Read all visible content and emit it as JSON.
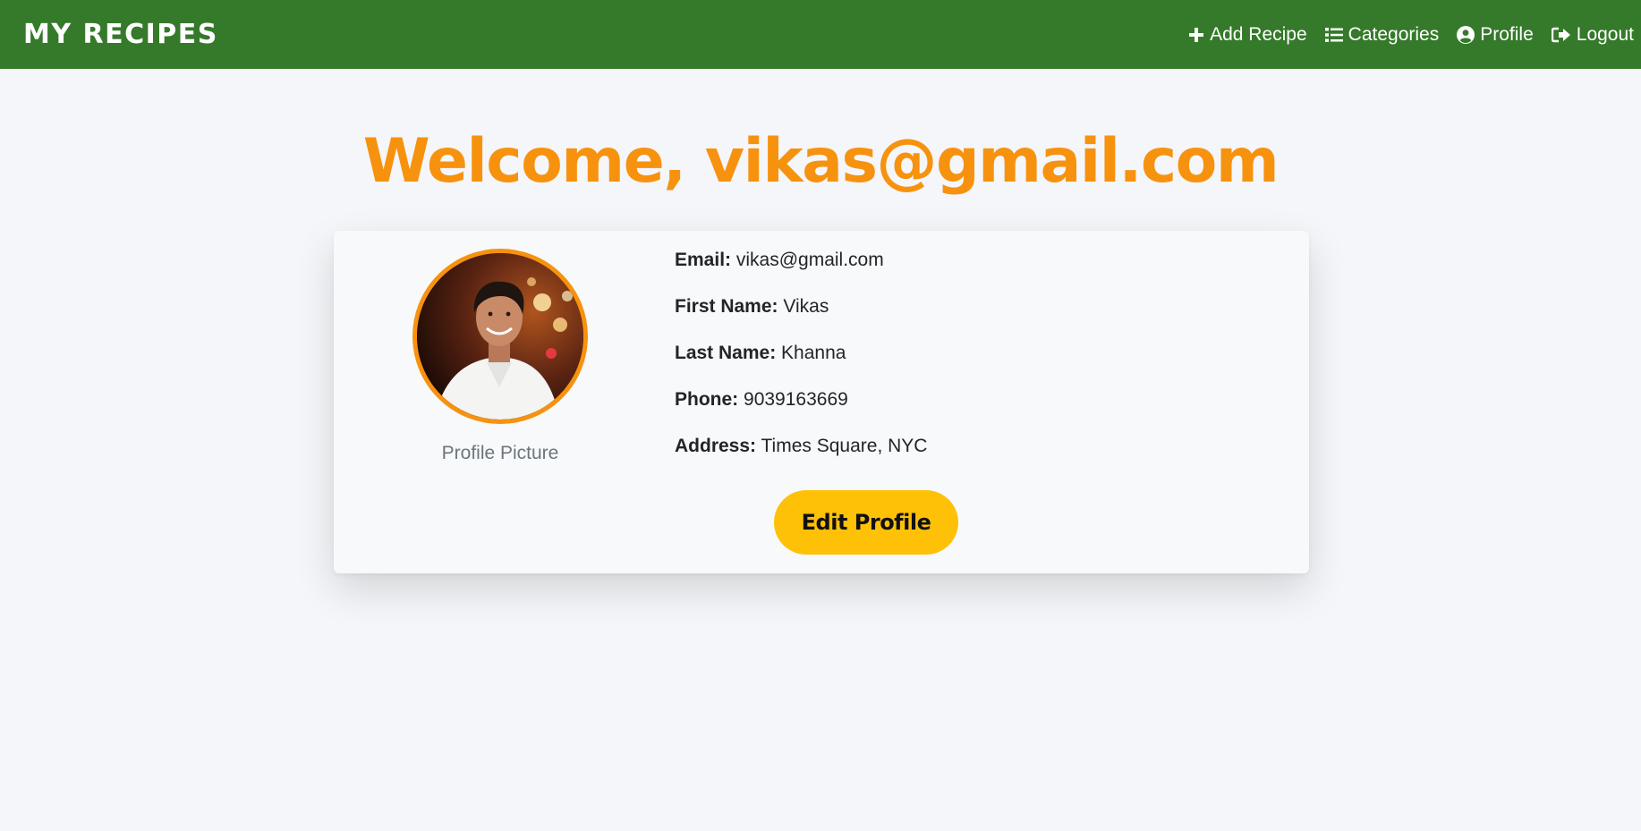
{
  "navbar": {
    "brand": "MY RECIPES",
    "links": [
      {
        "label": "Add Recipe",
        "icon": "plus-icon"
      },
      {
        "label": "Categories",
        "icon": "list-icon"
      },
      {
        "label": "Profile",
        "icon": "user-circle-icon"
      },
      {
        "label": "Logout",
        "icon": "sign-out-icon"
      }
    ]
  },
  "welcome": "Welcome, vikas@gmail.com",
  "profile": {
    "picture_caption": "Profile Picture",
    "fields": [
      {
        "label": "Email:",
        "value": "vikas@gmail.com"
      },
      {
        "label": "First Name:",
        "value": "Vikas"
      },
      {
        "label": "Last Name:",
        "value": "Khanna"
      },
      {
        "label": "Phone:",
        "value": "9039163669"
      },
      {
        "label": "Address:",
        "value": "Times Square, NYC"
      }
    ],
    "edit_button": "Edit Profile"
  },
  "colors": {
    "navbar": "#357a2a",
    "accent": "#f7920f",
    "button": "#ffc107",
    "background": "#f4f6f9"
  }
}
